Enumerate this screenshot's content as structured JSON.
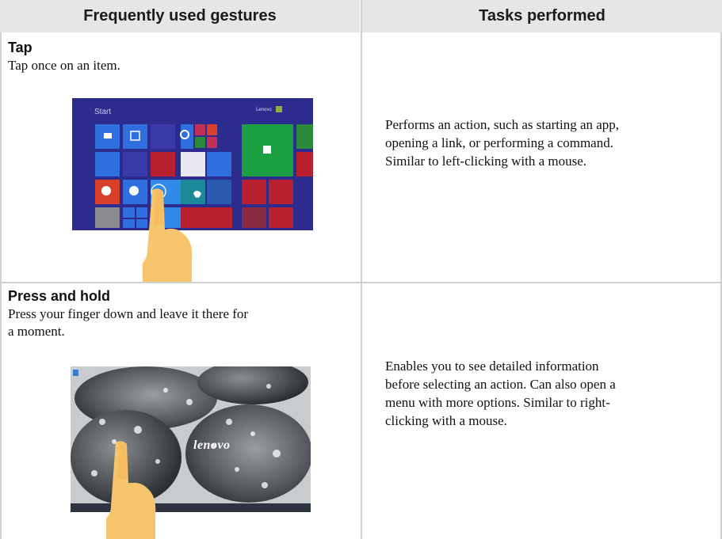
{
  "headers": {
    "gestures": "Frequently used gestures",
    "tasks": "Tasks performed"
  },
  "rows": [
    {
      "name": "Tap",
      "description": "Tap once on an item.",
      "task_lines": [
        "Performs an action, such as starting an app,",
        "opening a link, or performing a command.",
        "Similar to left-clicking with a mouse."
      ]
    },
    {
      "name": "Press and hold",
      "description_lines": [
        "Press your finger down and leave it there for",
        "a moment."
      ],
      "task_lines": [
        "Enables you to see detailed information",
        "before selecting an action. Can also open a",
        "menu with more options. Similar to right-",
        "clicking with a mouse."
      ]
    }
  ],
  "start_screen": {
    "title": "Start",
    "user": "Lenovo"
  },
  "desktop_screen": {
    "logo": "lenovo"
  },
  "colors": {
    "header_bg": "#e6e6e6",
    "grid_line": "#d0d0d0",
    "start_bg": "#2c2c8e",
    "finger": "#f7c56c"
  }
}
